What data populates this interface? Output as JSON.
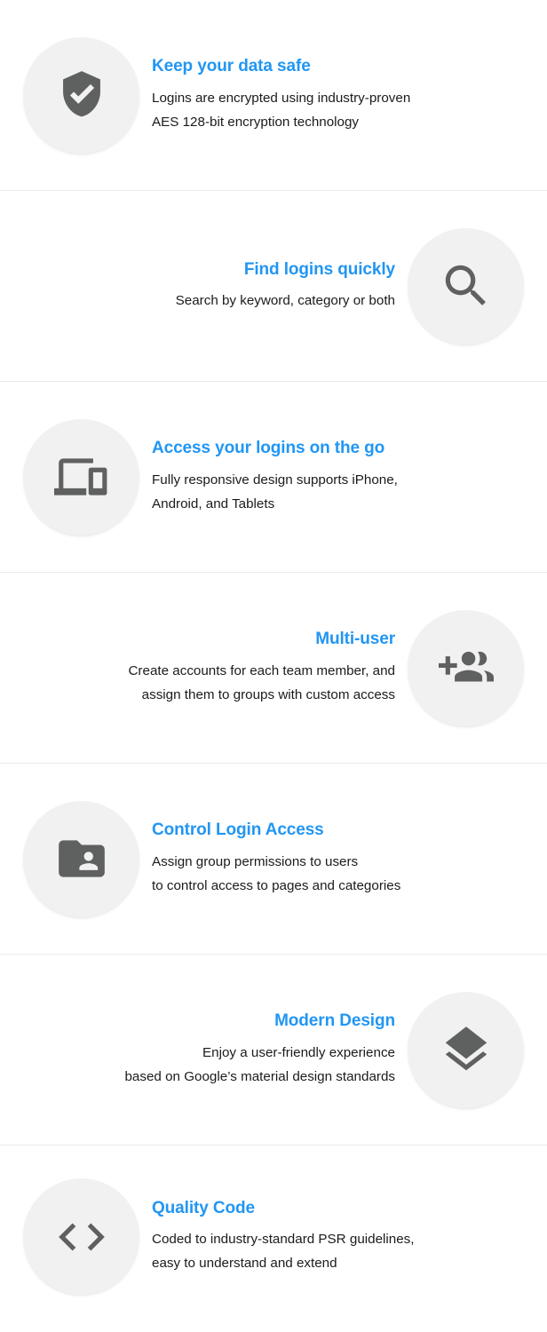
{
  "theme": {
    "accent_color": "#2196f3",
    "icon_color": "#5f6060",
    "bubble_color": "#f1f1f1",
    "text_color": "#1b1b1b",
    "divider_color": "#eaeaea",
    "page_background": "#ffffff"
  },
  "features": [
    {
      "icon": "shield-check-icon",
      "align": "left",
      "title": "Keep your data safe",
      "description": "Logins are encrypted using industry-proven\nAES 128-bit encryption technology"
    },
    {
      "icon": "search-icon",
      "align": "right",
      "title": "Find logins quickly",
      "description": "Search by keyword, category or both"
    },
    {
      "icon": "devices-icon",
      "align": "left",
      "title": "Access your logins on the go",
      "description": "Fully responsive design supports iPhone,\nAndroid, and Tablets"
    },
    {
      "icon": "group-add-icon",
      "align": "right",
      "title": "Multi-user",
      "description": "Create accounts for each team member, and\nassign them to groups with custom access"
    },
    {
      "icon": "folder-shared-icon",
      "align": "left",
      "title": "Control Login Access",
      "description": "Assign group permissions to users\nto control access to pages and categories"
    },
    {
      "icon": "layers-icon",
      "align": "right",
      "title": "Modern Design",
      "description": "Enjoy a user-friendly experience\nbased on Google’s material design standards"
    },
    {
      "icon": "code-icon",
      "align": "left",
      "title": "Quality Code",
      "description": "Coded to industry-standard PSR guidelines,\neasy to understand and extend"
    }
  ]
}
